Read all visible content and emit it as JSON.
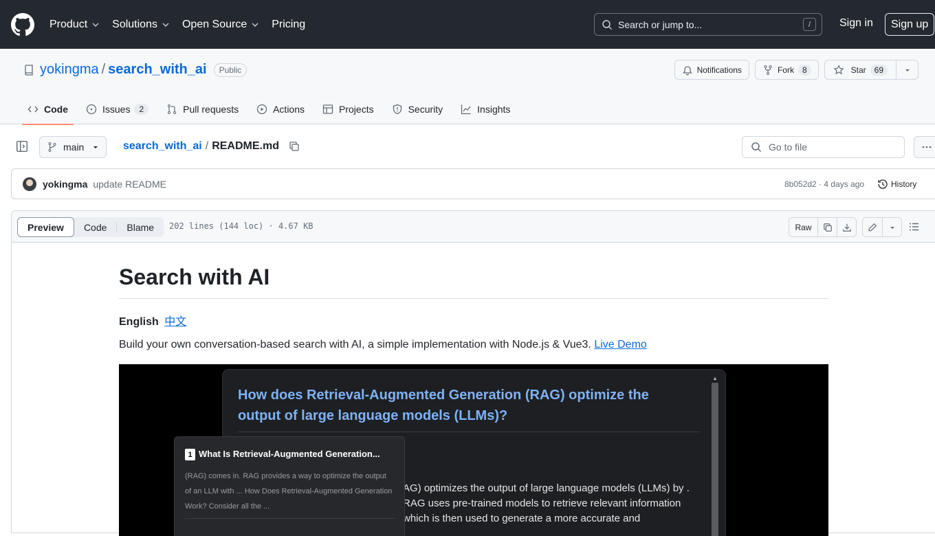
{
  "header": {
    "nav": [
      "Product",
      "Solutions",
      "Open Source",
      "Pricing"
    ],
    "search_placeholder": "Search or jump to...",
    "search_kbd": "/",
    "sign_in": "Sign in",
    "sign_up": "Sign up"
  },
  "repo": {
    "owner": "yokingma",
    "separator": "/",
    "name": "search_with_ai",
    "visibility": "Public",
    "notifications_label": "Notifications",
    "fork_label": "Fork",
    "fork_count": "8",
    "star_label": "Star",
    "star_count": "69"
  },
  "tabs": [
    {
      "label": "Code",
      "icon": "code-icon"
    },
    {
      "label": "Issues",
      "icon": "issue-icon",
      "count": "2"
    },
    {
      "label": "Pull requests",
      "icon": "pull-request-icon"
    },
    {
      "label": "Actions",
      "icon": "play-icon"
    },
    {
      "label": "Projects",
      "icon": "table-icon"
    },
    {
      "label": "Security",
      "icon": "shield-icon"
    },
    {
      "label": "Insights",
      "icon": "graph-icon"
    }
  ],
  "filebar": {
    "branch": "main",
    "crumb_repo": "search_with_ai",
    "crumb_sep": "/",
    "crumb_file": "README.md",
    "goto_placeholder": "Go to file"
  },
  "commit": {
    "author": "yokingma",
    "message": "update README",
    "sha_time": "8b052d2 · 4 days ago",
    "history": "History"
  },
  "file": {
    "views": [
      "Preview",
      "Code",
      "Blame"
    ],
    "meta": "202 lines (144 loc) · 4.67 KB",
    "raw": "Raw"
  },
  "readme": {
    "title": "Search with AI",
    "lang_current": "English",
    "lang_other": "中文",
    "desc": "Build your own conversation-based search with AI, a simple implementation with Node.js & Vue3.",
    "demo_link": "Live Demo",
    "demo": {
      "question": "How does Retrieval-Augmented Generation (RAG) optimize the output of large language models (LLMs)?",
      "answer": "AG) optimizes the output of large language models (LLMs) by . RAG uses pre-trained models to retrieve relevant information which is then used to generate a more accurate and",
      "tip_num": "1",
      "tip_title": "What Is Retrieval-Augmented Generation...",
      "tip_body": "(RAG) comes in. RAG provides a way to optimize the output of an LLM with ... How Does Retrieval-Augmented Generation Work? Consider all the ..."
    }
  },
  "colors": {
    "header_bg": "#24292f",
    "link": "#0969da",
    "active_tab_underline": "#fd8c73",
    "demo_question": "#7fb2f5"
  }
}
